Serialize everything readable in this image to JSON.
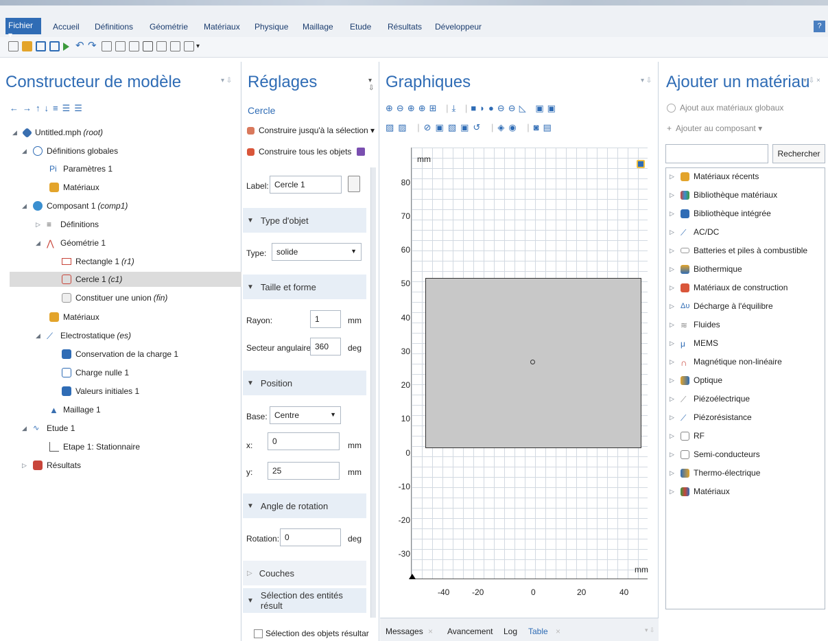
{
  "ribbon": {
    "file_label": "Fichier ▾",
    "tabs": [
      "Accueil",
      "Définitions",
      "Géométrie",
      "Matériaux",
      "Physique",
      "Maillage",
      "Etude",
      "Résultats",
      "Développeur"
    ],
    "help": "?"
  },
  "model_builder": {
    "title": "Constructeur de modèle",
    "tree": [
      {
        "label": "Untitled.mph",
        "tag": "(root)"
      },
      {
        "label": "Définitions globales",
        "tag": ""
      },
      {
        "label": "Paramètres 1",
        "tag": ""
      },
      {
        "label": "Matériaux",
        "tag": ""
      },
      {
        "label": "Composant 1",
        "tag": "(comp1)"
      },
      {
        "label": "Définitions",
        "tag": ""
      },
      {
        "label": "Géométrie 1",
        "tag": ""
      },
      {
        "label": "Rectangle 1",
        "tag": "(r1)"
      },
      {
        "label": "Cercle 1",
        "tag": "(c1)"
      },
      {
        "label": "Constituer une union",
        "tag": "(fin)"
      },
      {
        "label": "Matériaux",
        "tag": ""
      },
      {
        "label": "Electrostatique",
        "tag": "(es)"
      },
      {
        "label": "Conservation de la charge 1",
        "tag": ""
      },
      {
        "label": "Charge nulle 1",
        "tag": ""
      },
      {
        "label": "Valeurs initiales 1",
        "tag": ""
      },
      {
        "label": "Maillage 1",
        "tag": ""
      },
      {
        "label": "Etude 1",
        "tag": ""
      },
      {
        "label": "Etape 1: Stationnaire",
        "tag": ""
      },
      {
        "label": "Résultats",
        "tag": ""
      }
    ]
  },
  "settings": {
    "title": "Réglages",
    "subtitle": "Cercle",
    "build_selected": "Construire jusqu'à la sélection ▾",
    "build_all": "Construire tous les objets",
    "label_caption": "Label:",
    "label_value": "Cercle 1",
    "sections": {
      "object_type": "Type d'objet",
      "size_shape": "Taille et forme",
      "position": "Position",
      "rotation_angle": "Angle de rotation",
      "layers": "Couches",
      "result_selection": "Sélection des entités résult"
    },
    "type_caption": "Type:",
    "type_value": "solide",
    "radius_caption": "Rayon:",
    "radius_value": "1",
    "radius_unit": "mm",
    "sector_caption": "Secteur angulaire:",
    "sector_value": "360",
    "sector_unit": "deg",
    "base_caption": "Base:",
    "base_value": "Centre",
    "x_caption": "x:",
    "x_value": "0",
    "x_unit": "mm",
    "y_caption": "y:",
    "y_value": "25",
    "y_unit": "mm",
    "rotation_caption": "Rotation:",
    "rotation_value": "0",
    "rotation_unit": "deg",
    "result_checkbox": "Sélection des objets résultar"
  },
  "graphics": {
    "title": "Graphiques",
    "unit_top": "mm",
    "unit_bottom": "mm",
    "y_ticks": [
      "80",
      "70",
      "60",
      "50",
      "40",
      "30",
      "20",
      "10",
      "0",
      "-10",
      "-20",
      "-30"
    ],
    "x_ticks": [
      "-40",
      "-20",
      "0",
      "20",
      "40"
    ]
  },
  "materials": {
    "title": "Ajouter un matériau",
    "global": "Ajout aux matériaux globaux",
    "component": "Ajouter au composant ▾",
    "search_button": "Rechercher",
    "items": [
      "Matériaux récents",
      "Bibliothèque matériaux",
      "Bibliothèque intégrée",
      "AC/DC",
      "Batteries et piles à combustible",
      "Biothermique",
      "Matériaux de construction",
      "Décharge à l'équilibre",
      "Fluides",
      "MEMS",
      "Magnétique non-linéaire",
      "Optique",
      "Piézoélectrique",
      "Piézorésistance",
      "RF",
      "Semi-conducteurs",
      "Thermo-électrique",
      "Matériaux"
    ]
  },
  "bottom_tabs": [
    "Messages",
    "Avancement",
    "Log",
    "Table"
  ],
  "colors": {
    "accent": "#2f6cb5",
    "panel_header": "#e7eef6",
    "selection": "#dcdcdc",
    "geometry_fill": "#c8c8c8"
  }
}
